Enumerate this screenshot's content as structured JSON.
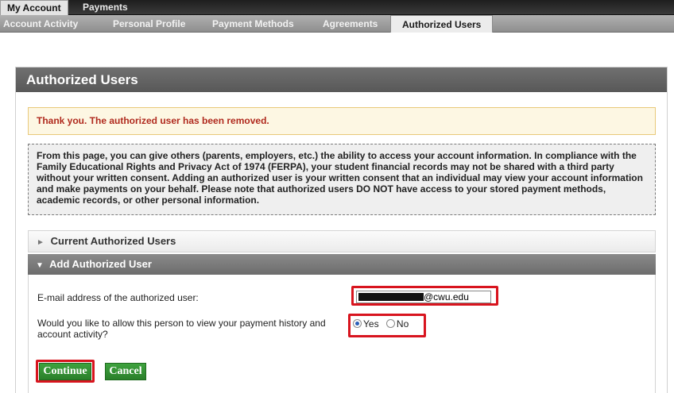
{
  "top_tabs": [
    {
      "label": "My Account",
      "active": true
    },
    {
      "label": "Payments",
      "active": false
    }
  ],
  "sub_tabs": [
    {
      "label": "Account Activity",
      "active": false
    },
    {
      "label": "Personal Profile",
      "active": false
    },
    {
      "label": "Payment Methods",
      "active": false
    },
    {
      "label": "Agreements",
      "active": false
    },
    {
      "label": "Authorized Users",
      "active": true
    }
  ],
  "panel": {
    "title": "Authorized Users",
    "alert": "Thank you. The authorized user has been removed.",
    "info": "From this page, you can give others (parents, employers, etc.) the ability to access your account information. In compliance with the Family Educational Rights and Privacy Act of 1974 (FERPA), your student financial records may not be shared with a third party without your written consent. Adding an authorized user is your written consent that an individual may view your account information and make payments on your behalf. Please note that authorized users DO NOT have access to your stored payment methods, academic records, or other personal information."
  },
  "sections": {
    "current": {
      "label": "Current Authorized Users",
      "arrow": "►"
    },
    "add": {
      "label": "Add Authorized User",
      "arrow": "▼"
    }
  },
  "form": {
    "email_label": "E-mail address of the authorized user:",
    "email_domain": "@cwu.edu",
    "history_question": "Would you like to allow this person to view your payment history and account activity?",
    "options": [
      {
        "label": "Yes",
        "selected": true
      },
      {
        "label": "No",
        "selected": false
      }
    ],
    "continue_label": "Continue",
    "cancel_label": "Cancel"
  },
  "colors": {
    "highlight": "#d8141e",
    "button_green": "#3fa33f",
    "alert_text": "#b02a1e",
    "radio_selected": "#2a5fb8"
  }
}
